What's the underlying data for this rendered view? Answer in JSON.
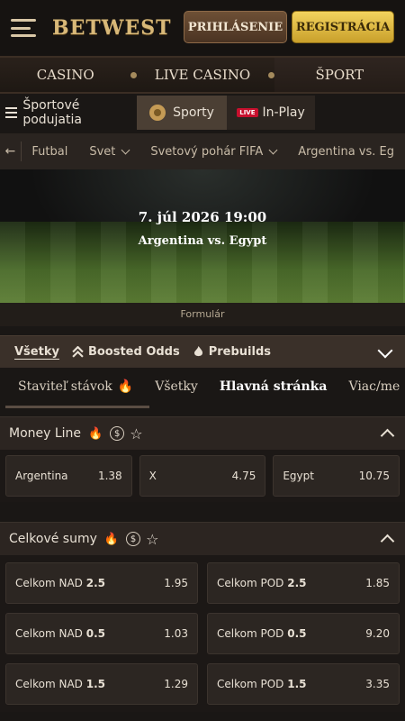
{
  "header": {
    "logo": "BETWEST",
    "login": "PRIHLÁSENIE",
    "register": "REGISTRÁCIA"
  },
  "main_nav": [
    "CASINO",
    "LIVE CASINO",
    "ŠPORT"
  ],
  "sub_nav": {
    "events": "Športové podujatia",
    "sports": "Sporty",
    "live_badge": "LIVE",
    "inplay": "In-Play"
  },
  "breadcrumbs": {
    "back": "←",
    "items": [
      "Futbal",
      "Svet",
      "Svetový pohár FIFA",
      "Argentina vs. Eg"
    ]
  },
  "hero": {
    "date": "7. júl 2026 19:00",
    "match": "Argentina vs. Egypt"
  },
  "form_label": "Formulár",
  "filters": [
    "Všetky",
    "Boosted Odds",
    "Prebuilds"
  ],
  "tabs": [
    "Staviteľ stávok",
    "Všetky",
    "Hlavná stránka",
    "Viac/me"
  ],
  "money_line": {
    "title": "Money Line",
    "odds": [
      {
        "label": "Argentina",
        "value": "1.38"
      },
      {
        "label": "X",
        "value": "4.75"
      },
      {
        "label": "Egypt",
        "value": "10.75"
      }
    ]
  },
  "totals": {
    "title": "Celkové sumy",
    "rows": [
      {
        "over_label": "Celkom NAD",
        "over_line": "2.5",
        "over_odds": "1.95",
        "under_label": "Celkom POD",
        "under_line": "2.5",
        "under_odds": "1.85"
      },
      {
        "over_label": "Celkom NAD",
        "over_line": "0.5",
        "over_odds": "1.03",
        "under_label": "Celkom POD",
        "under_line": "0.5",
        "under_odds": "9.20"
      },
      {
        "over_label": "Celkom NAD",
        "over_line": "1.5",
        "over_odds": "1.29",
        "under_label": "Celkom POD",
        "under_line": "1.5",
        "under_odds": "3.35"
      }
    ]
  }
}
